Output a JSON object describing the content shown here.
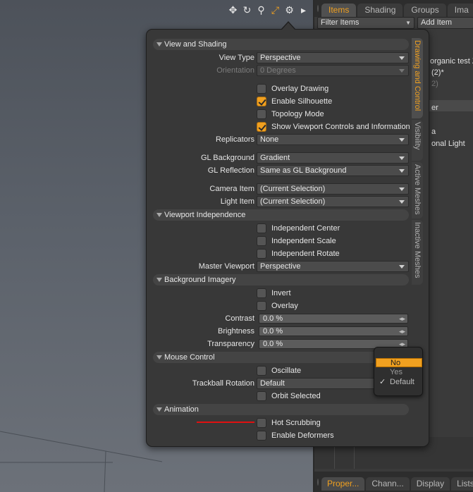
{
  "viewport_tools": [
    {
      "icon": "move-icon",
      "glyph": "✥"
    },
    {
      "icon": "rotate-icon",
      "glyph": "↻"
    },
    {
      "icon": "zoom-icon",
      "glyph": "⚲"
    },
    {
      "icon": "maximize-icon",
      "glyph": "⤢"
    },
    {
      "icon": "gear-icon",
      "glyph": "⚙"
    },
    {
      "icon": "play-arrow-icon",
      "glyph": "▸"
    }
  ],
  "right_panel": {
    "tabs": [
      "Items",
      "Shading",
      "Groups",
      "Ima"
    ],
    "active_tab": "Items",
    "filter_label": "Filter Items",
    "add_item_label": "Add Item",
    "visible_fragments": [
      "organic test Z",
      "(2)*",
      "2)",
      "er",
      "a",
      "onal Light"
    ],
    "bottom_tabs": [
      "Proper...",
      "Chann...",
      "Display",
      "Lists"
    ]
  },
  "popover": {
    "side_tabs": [
      "Drawing and Control",
      "Visibility",
      "Active Meshes",
      "Inactive Meshes"
    ],
    "active_side_tab": "Drawing and Control",
    "sections": {
      "view_shading": "View and Shading",
      "viewport_independence": "Viewport Independence",
      "background_imagery": "Background Imagery",
      "mouse_control": "Mouse Control",
      "animation": "Animation"
    },
    "fields": {
      "view_type": {
        "label": "View Type",
        "value": "Perspective"
      },
      "orientation": {
        "label": "Orientation",
        "value": "0 Degrees"
      },
      "overlay_drawing": {
        "label": "Overlay Drawing",
        "checked": false
      },
      "enable_silhouette": {
        "label": "Enable Silhouette",
        "checked": true
      },
      "topology_mode": {
        "label": "Topology Mode",
        "checked": false
      },
      "show_viewport_controls": {
        "label": "Show Viewport Controls and Information",
        "checked": true
      },
      "replicators": {
        "label": "Replicators",
        "value": "None"
      },
      "gl_background": {
        "label": "GL Background",
        "value": "Gradient"
      },
      "gl_reflection": {
        "label": "GL Reflection",
        "value": "Same as GL Background"
      },
      "camera_item": {
        "label": "Camera Item",
        "value": "(Current Selection)"
      },
      "light_item": {
        "label": "Light Item",
        "value": "(Current Selection)"
      },
      "independent_center": {
        "label": "Independent Center",
        "checked": false
      },
      "independent_scale": {
        "label": "Independent Scale",
        "checked": false
      },
      "independent_rotate": {
        "label": "Independent Rotate",
        "checked": false
      },
      "master_viewport": {
        "label": "Master Viewport",
        "value": "Perspective"
      },
      "invert": {
        "label": "Invert",
        "checked": false
      },
      "overlay": {
        "label": "Overlay",
        "checked": false
      },
      "contrast": {
        "label": "Contrast",
        "value": "0.0 %"
      },
      "brightness": {
        "label": "Brightness",
        "value": "0.0 %"
      },
      "transparency": {
        "label": "Transparency",
        "value": "0.0 %"
      },
      "oscillate": {
        "label": "Oscillate",
        "checked": false
      },
      "trackball_rotation": {
        "label": "Trackball Rotation",
        "value": "Default"
      },
      "orbit_selected": {
        "label": "Orbit Selected",
        "checked": false
      },
      "hot_scrubbing": {
        "label": "Hot Scrubbing",
        "checked": false
      },
      "enable_deformers": {
        "label": "Enable Deformers",
        "checked": false
      }
    }
  },
  "trackball_menu": {
    "options": [
      "No",
      "Yes",
      "Default"
    ],
    "highlighted": "No",
    "selected": "Default"
  },
  "colors": {
    "accent": "#f0a020",
    "annotation": "#e01010"
  }
}
